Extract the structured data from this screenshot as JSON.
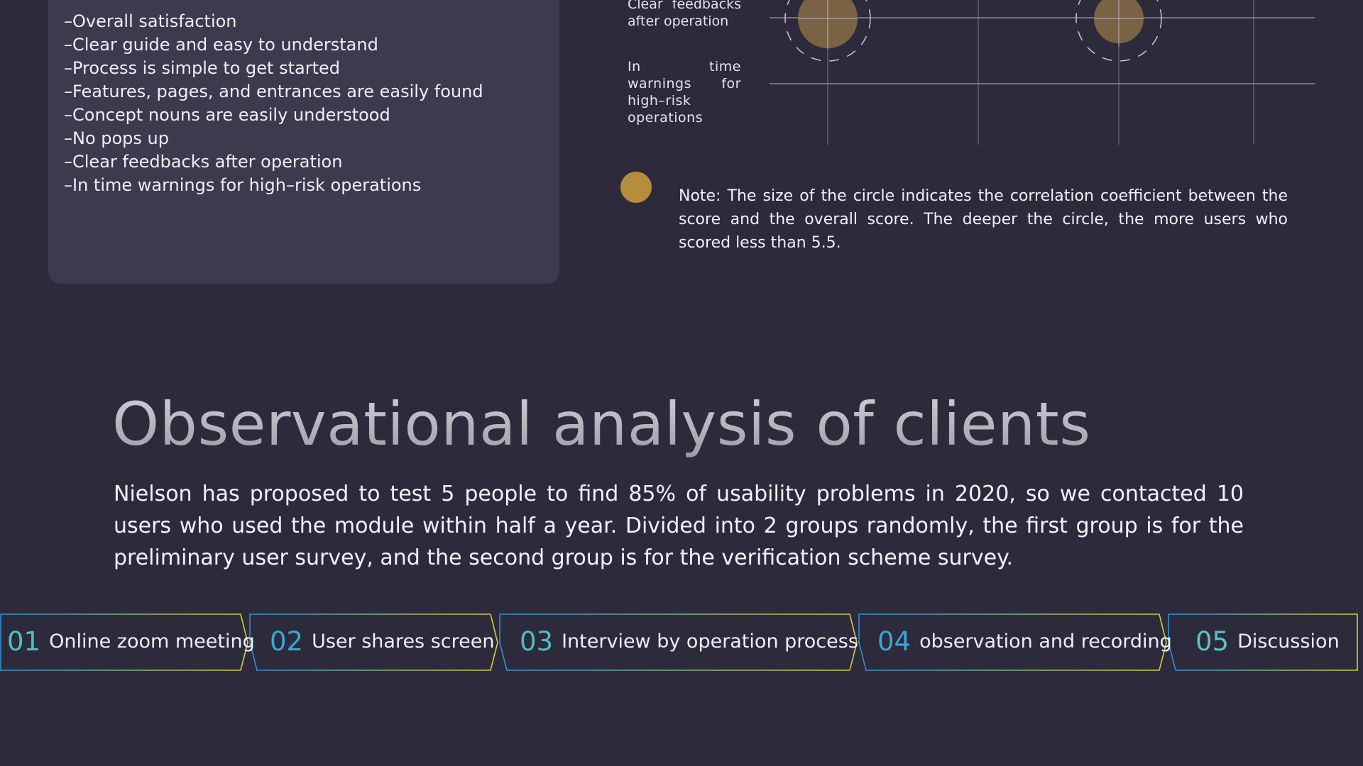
{
  "criteria_list": [
    "–Overall satisfaction",
    "–Clear guide and easy to understand",
    "–Process is simple to get started",
    "–Features, pages, and entrances are easily found",
    "–Concept nouns are easily understood",
    "–No pops up",
    "–Clear feedbacks after operation",
    "–In time warnings for high–risk operations"
  ],
  "matrix": {
    "row_labels": [
      "Clear feedbacks after operation",
      "In time warnings for high–risk operations"
    ]
  },
  "note": "Note: The size of the circle indicates the correlation coefficient between the score and the overall score. The deeper the circle, the more users who scored less than 5.5.",
  "title": "Observational analysis of clients",
  "intro": "Nielson has proposed to test 5 people to find 85% of usability problems in 2020, so we contacted 10 users who used the module within half a year. Divided into 2 groups randomly, the first group is for the preliminary user survey, and the second group is for the verification scheme survey.",
  "steps": [
    {
      "num": "01",
      "label": "Online zoom meeting"
    },
    {
      "num": "02",
      "label": "User shares screen"
    },
    {
      "num": "03",
      "label": "Interview by operation process"
    },
    {
      "num": "04",
      "label": "observation and recording"
    },
    {
      "num": "05",
      "label": "Discussion"
    }
  ],
  "colors": {
    "background": "#2d2a3b",
    "card": "#3d3a4d",
    "circle": "#b58d3c",
    "accent_blue": "#3aa7d6",
    "accent_yellow": "#d8d84a"
  }
}
